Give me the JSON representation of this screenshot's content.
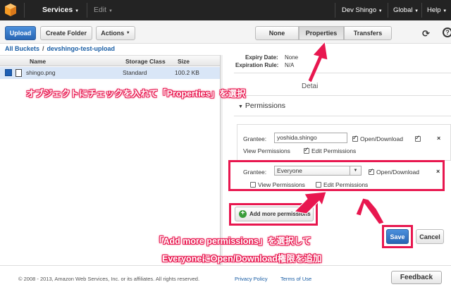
{
  "nav": {
    "services": "Services",
    "edit": "Edit",
    "user": "Dev Shingo",
    "region": "Global",
    "help": "Help"
  },
  "toolbar": {
    "upload": "Upload",
    "create_folder": "Create Folder",
    "actions": "Actions",
    "none": "None",
    "properties": "Properties",
    "transfers": "Transfers"
  },
  "breadcrumb": {
    "root": "All Buckets",
    "sep": "/",
    "bucket": "devshingo-test-upload"
  },
  "table": {
    "headers": [
      "Name",
      "Storage Class",
      "Size"
    ],
    "rows": [
      {
        "name": "shingo.png",
        "storage_class": "Standard",
        "size": "100.2 KB"
      }
    ]
  },
  "details": {
    "expiry_date_label": "Expiry Date:",
    "expiry_date_value": "None",
    "expiration_rule_label": "Expiration Rule:",
    "expiration_rule_value": "N/A",
    "details_section": "Detai",
    "permissions_title": "Permissions"
  },
  "permissions": {
    "grantee_label": "Grantee:",
    "grant1": {
      "grantee": "yoshida.shingo",
      "open_download": "Open/Download",
      "view_permissions": "View Permissions",
      "edit_permissions": "Edit Permissions"
    },
    "grant2": {
      "grantee": "Everyone",
      "open_download": "Open/Download",
      "view_permissions": "View Permissions",
      "edit_permissions": "Edit Permissions"
    },
    "add_more": "Add more permissions",
    "save": "Save",
    "cancel": "Cancel",
    "close": "×"
  },
  "annotations": {
    "step1": "オブジェクトにチェックを入れて「Properties」を選択",
    "step2": "「Add more permissions」を選択して",
    "step3": "EveryoneにOpen/Download権限を追加"
  },
  "footer": {
    "copyright": "© 2008 - 2013, Amazon Web Services, Inc. or its affiliates. All rights reserved.",
    "privacy": "Privacy Policy",
    "terms": "Terms of Use",
    "feedback": "Feedback"
  },
  "colors": {
    "highlight": "#e8174f",
    "primary": "#2866b4",
    "topbar": "#232323"
  }
}
